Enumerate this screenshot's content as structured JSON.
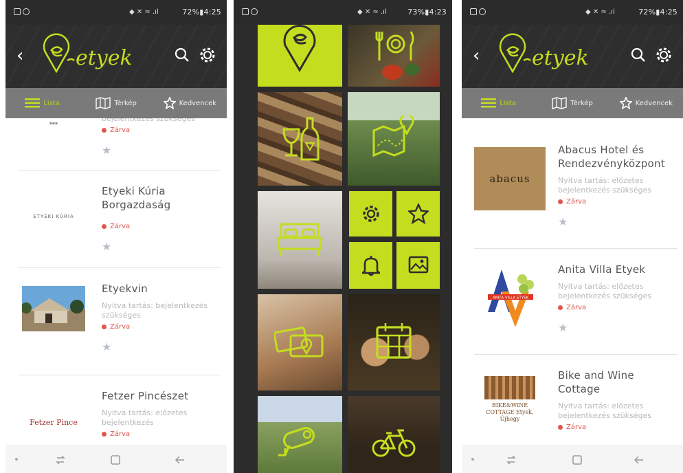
{
  "colors": {
    "accent": "#c4dd1f",
    "appbar": "#2e2e2e",
    "tabbar": "#7a7a7a",
    "closed": "#e0564f"
  },
  "screens": [
    {
      "statusbar": {
        "right": "72%▮4:25"
      },
      "appbar": {
        "brand": "etyek"
      },
      "tabs": [
        {
          "label": "Lista",
          "icon": "list-icon"
        },
        {
          "label": "Térkép",
          "icon": "map-icon"
        },
        {
          "label": "Kedvencek",
          "icon": "star-icon"
        }
      ],
      "items": [
        {
          "name": "",
          "hours": "bejelentkezés szükséges",
          "status": "Zárva",
          "logo_text": ""
        },
        {
          "name": "Etyeki Kúria Borgazdaság",
          "hours": "",
          "status": "Zárva",
          "logo_text": "ETYEKI KÚRIA"
        },
        {
          "name": "Etyekvin",
          "hours": "Nyitva tartás: bejelentkezés szükséges",
          "status": "Zárva",
          "logo_text": ""
        },
        {
          "name": "Fetzer Pincészet",
          "hours": "Nyitva tartás: előzetes bejelentkezés",
          "status": "Zárva",
          "logo_text": "Fetzer Pince"
        }
      ]
    },
    {
      "statusbar": {
        "right": "73%▮4:23"
      },
      "menu_tiles": [
        "logo-tile",
        "food-tile",
        "wine-tile",
        "map-tile",
        "accommodation-tile",
        "settings-tile",
        "favorites-tile",
        "notifications-tile",
        "gallery-tile",
        "payment-tile",
        "events-tile",
        "camera-tile",
        "bike-tile"
      ]
    },
    {
      "statusbar": {
        "right": "72%▮4:25"
      },
      "appbar": {
        "brand": "etyek"
      },
      "tabs": [
        {
          "label": "Lista",
          "icon": "list-icon"
        },
        {
          "label": "Térkép",
          "icon": "map-icon"
        },
        {
          "label": "Kedvencek",
          "icon": "star-icon"
        }
      ],
      "items": [
        {
          "name": "Abacus Hotel és Rendezvényközpont",
          "hours": "Nyitva tartás: előzetes bejelentkezés szükséges",
          "status": "Zárva",
          "logo_text": "abacus"
        },
        {
          "name": "Anita Villa Etyek",
          "hours": "Nyitva tartás: előzetes bejelentkezés szükséges",
          "status": "Zárva",
          "logo_text": "ANITA VILLA ETYEK"
        },
        {
          "name": "Bike and Wine Cottage",
          "hours": "Nyitva tartás: előzetes bejelentkezés szükséges",
          "status": "Zárva",
          "logo_text": "BIKE&WINE COTTAGE Etyek, Újhegy"
        }
      ]
    }
  ]
}
